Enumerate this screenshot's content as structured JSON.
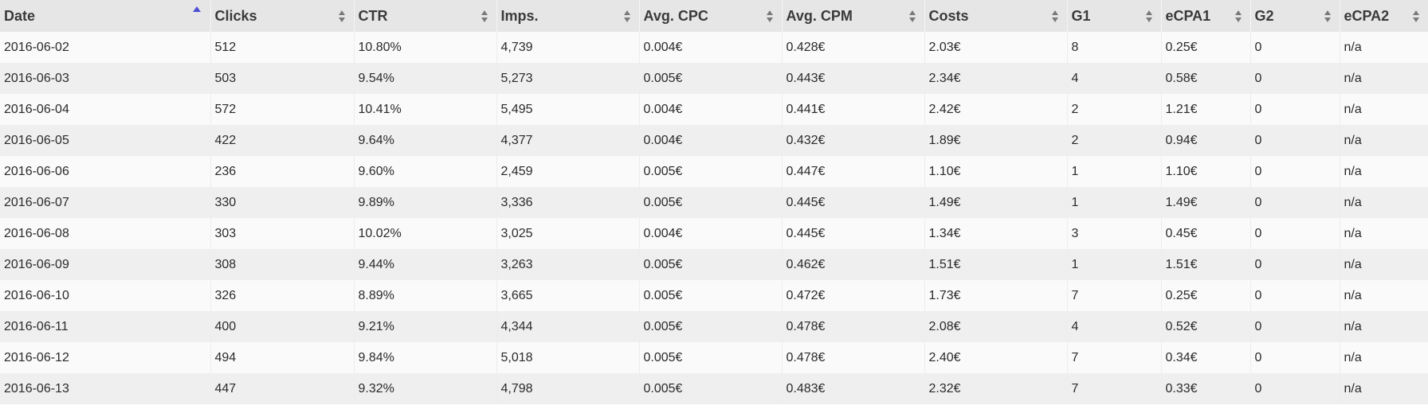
{
  "table": {
    "sorted_column": "date",
    "sort_direction": "ascending",
    "accent_color": "#4b4fd1",
    "headers": {
      "date": "Date",
      "clicks": "Clicks",
      "ctr": "CTR",
      "imps": "Imps.",
      "avg_cpc": "Avg. CPC",
      "avg_cpm": "Avg. CPM",
      "costs": "Costs",
      "g1": "G1",
      "ecpa1": "eCPA1",
      "g2": "G2",
      "ecpa2": "eCPA2"
    },
    "rows": [
      {
        "date": "2016-06-02",
        "clicks": "512",
        "ctr": "10.80%",
        "imps": "4,739",
        "avg_cpc": "0.004€",
        "avg_cpm": "0.428€",
        "costs": "2.03€",
        "g1": "8",
        "ecpa1": "0.25€",
        "g2": "0",
        "ecpa2": "n/a"
      },
      {
        "date": "2016-06-03",
        "clicks": "503",
        "ctr": "9.54%",
        "imps": "5,273",
        "avg_cpc": "0.005€",
        "avg_cpm": "0.443€",
        "costs": "2.34€",
        "g1": "4",
        "ecpa1": "0.58€",
        "g2": "0",
        "ecpa2": "n/a"
      },
      {
        "date": "2016-06-04",
        "clicks": "572",
        "ctr": "10.41%",
        "imps": "5,495",
        "avg_cpc": "0.004€",
        "avg_cpm": "0.441€",
        "costs": "2.42€",
        "g1": "2",
        "ecpa1": "1.21€",
        "g2": "0",
        "ecpa2": "n/a"
      },
      {
        "date": "2016-06-05",
        "clicks": "422",
        "ctr": "9.64%",
        "imps": "4,377",
        "avg_cpc": "0.004€",
        "avg_cpm": "0.432€",
        "costs": "1.89€",
        "g1": "2",
        "ecpa1": "0.94€",
        "g2": "0",
        "ecpa2": "n/a"
      },
      {
        "date": "2016-06-06",
        "clicks": "236",
        "ctr": "9.60%",
        "imps": "2,459",
        "avg_cpc": "0.005€",
        "avg_cpm": "0.447€",
        "costs": "1.10€",
        "g1": "1",
        "ecpa1": "1.10€",
        "g2": "0",
        "ecpa2": "n/a"
      },
      {
        "date": "2016-06-07",
        "clicks": "330",
        "ctr": "9.89%",
        "imps": "3,336",
        "avg_cpc": "0.005€",
        "avg_cpm": "0.445€",
        "costs": "1.49€",
        "g1": "1",
        "ecpa1": "1.49€",
        "g2": "0",
        "ecpa2": "n/a"
      },
      {
        "date": "2016-06-08",
        "clicks": "303",
        "ctr": "10.02%",
        "imps": "3,025",
        "avg_cpc": "0.004€",
        "avg_cpm": "0.445€",
        "costs": "1.34€",
        "g1": "3",
        "ecpa1": "0.45€",
        "g2": "0",
        "ecpa2": "n/a"
      },
      {
        "date": "2016-06-09",
        "clicks": "308",
        "ctr": "9.44%",
        "imps": "3,263",
        "avg_cpc": "0.005€",
        "avg_cpm": "0.462€",
        "costs": "1.51€",
        "g1": "1",
        "ecpa1": "1.51€",
        "g2": "0",
        "ecpa2": "n/a"
      },
      {
        "date": "2016-06-10",
        "clicks": "326",
        "ctr": "8.89%",
        "imps": "3,665",
        "avg_cpc": "0.005€",
        "avg_cpm": "0.472€",
        "costs": "1.73€",
        "g1": "7",
        "ecpa1": "0.25€",
        "g2": "0",
        "ecpa2": "n/a"
      },
      {
        "date": "2016-06-11",
        "clicks": "400",
        "ctr": "9.21%",
        "imps": "4,344",
        "avg_cpc": "0.005€",
        "avg_cpm": "0.478€",
        "costs": "2.08€",
        "g1": "4",
        "ecpa1": "0.52€",
        "g2": "0",
        "ecpa2": "n/a"
      },
      {
        "date": "2016-06-12",
        "clicks": "494",
        "ctr": "9.84%",
        "imps": "5,018",
        "avg_cpc": "0.005€",
        "avg_cpm": "0.478€",
        "costs": "2.40€",
        "g1": "7",
        "ecpa1": "0.34€",
        "g2": "0",
        "ecpa2": "n/a"
      },
      {
        "date": "2016-06-13",
        "clicks": "447",
        "ctr": "9.32%",
        "imps": "4,798",
        "avg_cpc": "0.005€",
        "avg_cpm": "0.483€",
        "costs": "2.32€",
        "g1": "7",
        "ecpa1": "0.33€",
        "g2": "0",
        "ecpa2": "n/a"
      }
    ]
  }
}
